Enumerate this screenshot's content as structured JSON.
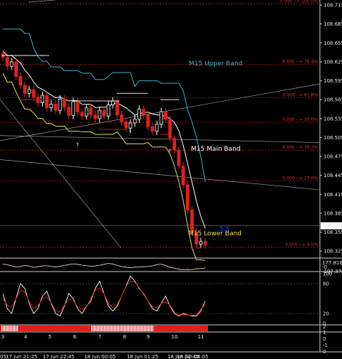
{
  "chart_data": {
    "type": "candlestick",
    "instrument_panel": {
      "price_scale": [
        "108.715",
        "108.685",
        "108.655",
        "108.625",
        "108.595",
        "108.565",
        "108.535",
        "108.505",
        "108.475",
        "108.445",
        "108.415",
        "108.385",
        "108.355",
        "108.325"
      ],
      "current_price": "108.365",
      "ylim": [
        108.315,
        108.723
      ],
      "fib_levels": [
        {
          "label": "0.000 --> 100.0%",
          "price": 108.717
        },
        {
          "label": "0.000 --> 76.4%",
          "price": 108.621
        },
        {
          "label": "0.000 --> 61.8%",
          "price": 108.568
        },
        {
          "label": "0.000 --> 50.0%",
          "price": 108.529
        },
        {
          "label": "0.000 --> 38.2%",
          "price": 108.485
        },
        {
          "label": "0.000 --> 23.6%",
          "price": 108.436
        },
        {
          "label": "0.000 --> 0.0%",
          "price": 108.331
        }
      ],
      "bands": {
        "upper": {
          "label": "M15 Upper Band",
          "color": "#3fb3c9"
        },
        "main": {
          "label": "M15 Main Band",
          "color": "#ffffff"
        },
        "lower": {
          "label": "M15 Lower Band",
          "color": "#e8e05a"
        }
      },
      "corner_label": "5.5",
      "close_series": [
        108.632,
        108.618,
        108.625,
        108.602,
        108.588,
        108.575,
        108.581,
        108.569,
        108.56,
        108.572,
        108.552,
        108.558,
        108.548,
        108.566,
        108.553,
        108.54,
        108.562,
        108.545,
        108.539,
        108.552,
        108.541,
        108.535,
        108.548,
        108.539,
        108.557,
        108.563,
        108.541,
        108.53,
        108.52,
        108.528,
        108.534,
        108.55,
        108.541,
        108.522,
        108.515,
        108.526,
        108.546,
        108.534,
        108.504,
        108.485,
        108.46,
        108.43,
        108.39,
        108.355,
        108.336,
        108.34,
        108.335
      ]
    },
    "indicator_1": {
      "scale": [
        "177.8186",
        "-0",
        "-197.376"
      ],
      "values": [
        30,
        10,
        -40,
        -80,
        -60,
        -20,
        -50,
        -90,
        -70,
        -40,
        -30,
        -60,
        -80,
        -50,
        -20,
        10,
        40,
        20,
        -10,
        -30,
        -50,
        -40,
        -10,
        20,
        60,
        30,
        -20,
        -60,
        -90,
        -110,
        -90,
        -80,
        -70,
        -60,
        -40,
        10,
        30,
        -20,
        -90,
        -120,
        -170,
        -180,
        -190,
        -170,
        -150,
        -140,
        -120
      ]
    },
    "indicator_2": {
      "scale": [
        "100",
        "80",
        "20",
        "0"
      ],
      "values": [
        60,
        30,
        20,
        50,
        80,
        70,
        40,
        20,
        30,
        55,
        65,
        40,
        20,
        15,
        35,
        60,
        50,
        30,
        20,
        35,
        45,
        70,
        85,
        60,
        35,
        25,
        35,
        55,
        75,
        95,
        85,
        70,
        60,
        45,
        30,
        25,
        40,
        55,
        35,
        20,
        15,
        20,
        18,
        15,
        15,
        25,
        45
      ]
    },
    "indicator_3": {
      "scale": [
        "2",
        "1",
        "0",
        "-1"
      ],
      "numbers": [
        "3",
        "4",
        "5",
        "6",
        "7",
        "8",
        "9",
        "10",
        "11"
      ]
    },
    "time_axis": [
      "05",
      "17 Jun 21:25",
      "17 Jun 22:45",
      "18 Jun 00:05",
      "18 Jun 01:25",
      "18 Jun 02:45",
      "18 Jun 04:05"
    ]
  }
}
